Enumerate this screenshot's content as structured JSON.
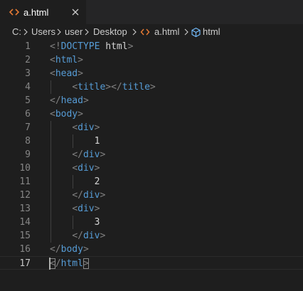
{
  "tab": {
    "label": "a.html",
    "icon": "html-file-icon",
    "icon_color": "#e37933"
  },
  "breadcrumb": {
    "items": [
      "C:",
      "Users",
      "user",
      "Desktop",
      "a.html",
      "html"
    ]
  },
  "editor": {
    "active_line": 17,
    "lines": [
      {
        "n": "1",
        "tokens": [
          [
            "p",
            "<!"
          ],
          [
            "t",
            "DOCTYPE"
          ],
          [
            "x",
            " "
          ],
          [
            "x",
            "html"
          ],
          [
            "p",
            ">"
          ]
        ]
      },
      {
        "n": "2",
        "tokens": [
          [
            "p",
            "<"
          ],
          [
            "t",
            "html"
          ],
          [
            "p",
            ">"
          ]
        ]
      },
      {
        "n": "3",
        "tokens": [
          [
            "p",
            "<"
          ],
          [
            "t",
            "head"
          ],
          [
            "p",
            ">"
          ]
        ]
      },
      {
        "n": "4",
        "tokens": [
          [
            "x",
            "    "
          ],
          [
            "p",
            "<"
          ],
          [
            "t",
            "title"
          ],
          [
            "p",
            "></"
          ],
          [
            "t",
            "title"
          ],
          [
            "p",
            ">"
          ]
        ]
      },
      {
        "n": "5",
        "tokens": [
          [
            "p",
            "</"
          ],
          [
            "t",
            "head"
          ],
          [
            "p",
            ">"
          ]
        ]
      },
      {
        "n": "6",
        "tokens": [
          [
            "p",
            "<"
          ],
          [
            "t",
            "body"
          ],
          [
            "p",
            ">"
          ]
        ]
      },
      {
        "n": "7",
        "tokens": [
          [
            "x",
            "    "
          ],
          [
            "p",
            "<"
          ],
          [
            "t",
            "div"
          ],
          [
            "p",
            ">"
          ]
        ]
      },
      {
        "n": "8",
        "tokens": [
          [
            "x",
            "        1"
          ]
        ]
      },
      {
        "n": "9",
        "tokens": [
          [
            "x",
            "    "
          ],
          [
            "p",
            "</"
          ],
          [
            "t",
            "div"
          ],
          [
            "p",
            ">"
          ]
        ]
      },
      {
        "n": "10",
        "tokens": [
          [
            "x",
            "    "
          ],
          [
            "p",
            "<"
          ],
          [
            "t",
            "div"
          ],
          [
            "p",
            ">"
          ]
        ]
      },
      {
        "n": "11",
        "tokens": [
          [
            "x",
            "        2"
          ]
        ]
      },
      {
        "n": "12",
        "tokens": [
          [
            "x",
            "    "
          ],
          [
            "p",
            "</"
          ],
          [
            "t",
            "div"
          ],
          [
            "p",
            ">"
          ]
        ]
      },
      {
        "n": "13",
        "tokens": [
          [
            "x",
            "    "
          ],
          [
            "p",
            "<"
          ],
          [
            "t",
            "div"
          ],
          [
            "p",
            ">"
          ]
        ]
      },
      {
        "n": "14",
        "tokens": [
          [
            "x",
            "        3"
          ]
        ]
      },
      {
        "n": "15",
        "tokens": [
          [
            "x",
            "    "
          ],
          [
            "p",
            "</"
          ],
          [
            "t",
            "div"
          ],
          [
            "p",
            ">"
          ]
        ]
      },
      {
        "n": "16",
        "tokens": [
          [
            "p",
            "</"
          ],
          [
            "t",
            "body"
          ],
          [
            "p",
            ">"
          ]
        ]
      },
      {
        "n": "17",
        "tokens": [
          [
            "pb",
            "<"
          ],
          [
            "p",
            "/"
          ],
          [
            "t",
            "html"
          ],
          [
            "pb",
            ">"
          ]
        ]
      }
    ]
  },
  "colors": {
    "background": "#1e1e1e",
    "tag": "#569cd6",
    "punctuation": "#808080",
    "text": "#d4d4d4",
    "line_number": "#858585",
    "line_number_active": "#c6c6c6"
  }
}
